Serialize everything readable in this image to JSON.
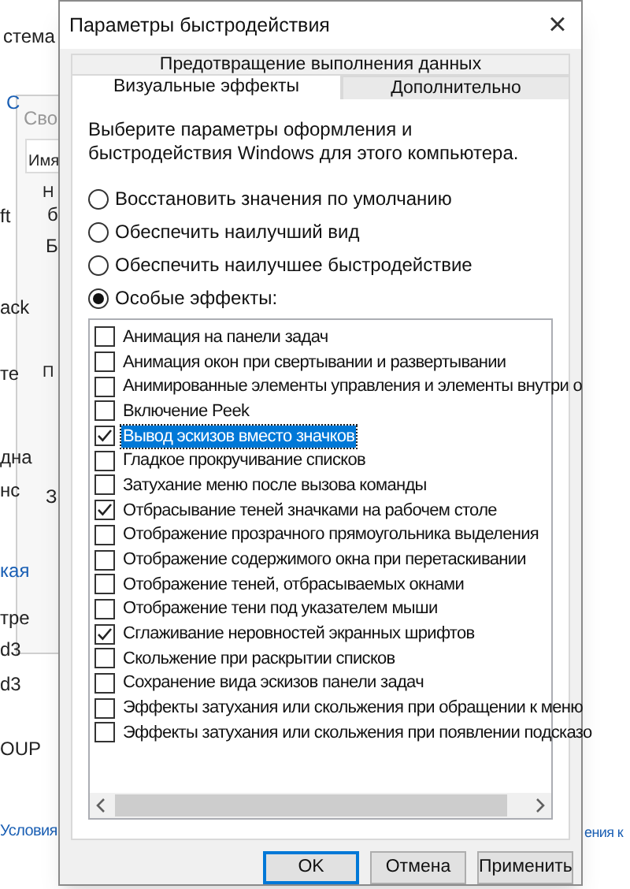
{
  "background": {
    "fragments": [
      {
        "text": "стема",
        "kind": "plain"
      },
      {
        "text": "С",
        "kind": "link"
      },
      {
        "text": "Сво",
        "kind": "title"
      },
      {
        "text": "Имя",
        "kind": "plain"
      },
      {
        "text": "Н",
        "kind": "plain"
      },
      {
        "text": "б",
        "kind": "plain"
      },
      {
        "text": "ft",
        "kind": "plain"
      },
      {
        "text": "Б",
        "kind": "plain"
      },
      {
        "text": "ack",
        "kind": "plain"
      },
      {
        "text": "те",
        "kind": "plain"
      },
      {
        "text": "П",
        "kind": "plain"
      },
      {
        "text": "дна",
        "kind": "plain"
      },
      {
        "text": "нс",
        "kind": "plain"
      },
      {
        "text": "З",
        "kind": "plain"
      },
      {
        "text": "кая",
        "kind": "link"
      },
      {
        "text": "тре",
        "kind": "plain"
      },
      {
        "text": "d3",
        "kind": "plain"
      },
      {
        "text": "d3",
        "kind": "plain"
      },
      {
        "text": "OUP",
        "kind": "plain"
      },
      {
        "text": "Условия",
        "kind": "link"
      },
      {
        "text": "ения к",
        "kind": "link"
      }
    ]
  },
  "window": {
    "title": "Параметры быстродействия",
    "close": "×"
  },
  "tabs": [
    {
      "label": "Предотвращение выполнения данных",
      "selected": false,
      "kind": "back"
    },
    {
      "label": "Визуальные эффекты",
      "selected": true,
      "kind": "front"
    },
    {
      "label": "Дополнительно",
      "selected": false,
      "kind": "front"
    }
  ],
  "description": "Выберите параметры оформления и быстродействия Windows для этого компьютера.",
  "options": [
    {
      "label": "Восстановить значения по умолчанию",
      "selected": false
    },
    {
      "label": "Обеспечить наилучший вид",
      "selected": false
    },
    {
      "label": "Обеспечить наилучшее быстродействие",
      "selected": false
    },
    {
      "label": "Особые эффекты:",
      "selected": true
    }
  ],
  "effects": [
    {
      "label": "Анимация на панели задач",
      "checked": false,
      "selected": false
    },
    {
      "label": "Анимация окон при свертывании и развертывании",
      "checked": false,
      "selected": false
    },
    {
      "label": "Анимированные элементы управления и элементы внутри о",
      "checked": false,
      "selected": false
    },
    {
      "label": "Включение Peek",
      "checked": false,
      "selected": false
    },
    {
      "label": "Вывод эскизов вместо значков",
      "checked": true,
      "selected": true
    },
    {
      "label": "Гладкое прокручивание списков",
      "checked": false,
      "selected": false
    },
    {
      "label": "Затухание меню после вызова команды",
      "checked": false,
      "selected": false
    },
    {
      "label": "Отбрасывание теней значками на рабочем столе",
      "checked": true,
      "selected": false
    },
    {
      "label": "Отображение прозрачного прямоугольника выделения",
      "checked": false,
      "selected": false
    },
    {
      "label": "Отображение содержимого окна при перетаскивании",
      "checked": false,
      "selected": false
    },
    {
      "label": "Отображение теней, отбрасываемых окнами",
      "checked": false,
      "selected": false
    },
    {
      "label": "Отображение тени под указателем мыши",
      "checked": false,
      "selected": false
    },
    {
      "label": "Сглаживание неровностей экранных шрифтов",
      "checked": true,
      "selected": false
    },
    {
      "label": "Скольжение при раскрытии списков",
      "checked": false,
      "selected": false
    },
    {
      "label": "Сохранение вида эскизов панели задач",
      "checked": false,
      "selected": false
    },
    {
      "label": "Эффекты затухания или скольжения при обращении к меню",
      "checked": false,
      "selected": false
    },
    {
      "label": "Эффекты затухания или скольжения при появлении подсказо",
      "checked": false,
      "selected": false
    }
  ],
  "buttons": [
    {
      "label": "OK",
      "kind": "default"
    },
    {
      "label": "Отмена",
      "kind": "normal"
    },
    {
      "label": "Применить",
      "kind": "normal"
    }
  ]
}
